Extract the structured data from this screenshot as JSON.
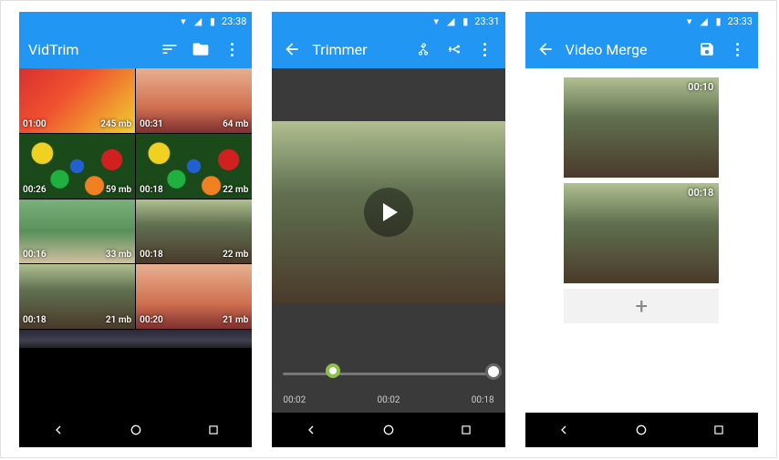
{
  "screen1": {
    "status_time": "23:38",
    "title": "VidTrim",
    "cells": [
      {
        "dur": "01:00",
        "size": "245 mb",
        "cls": "t-play"
      },
      {
        "dur": "00:31",
        "size": "64 mb",
        "cls": "t-kid"
      },
      {
        "dur": "00:26",
        "size": "59 mb",
        "cls": "t-balls"
      },
      {
        "dur": "00:18",
        "size": "22 mb",
        "cls": "t-balls"
      },
      {
        "dur": "00:16",
        "size": "33 mb",
        "cls": "t-room"
      },
      {
        "dur": "00:18",
        "size": "22 mb",
        "cls": "t-forest"
      },
      {
        "dur": "00:18",
        "size": "21 mb",
        "cls": "t-forest"
      },
      {
        "dur": "00:20",
        "size": "21 mb",
        "cls": "t-kid"
      }
    ]
  },
  "screen2": {
    "status_time": "23:31",
    "title": "Trimmer",
    "t_start": "00:02",
    "t_mid": "00:02",
    "t_end": "00:18"
  },
  "screen3": {
    "status_time": "23:33",
    "title": "Video Merge",
    "items": [
      {
        "dur": "00:10"
      },
      {
        "dur": "00:18"
      }
    ],
    "add": "+"
  }
}
